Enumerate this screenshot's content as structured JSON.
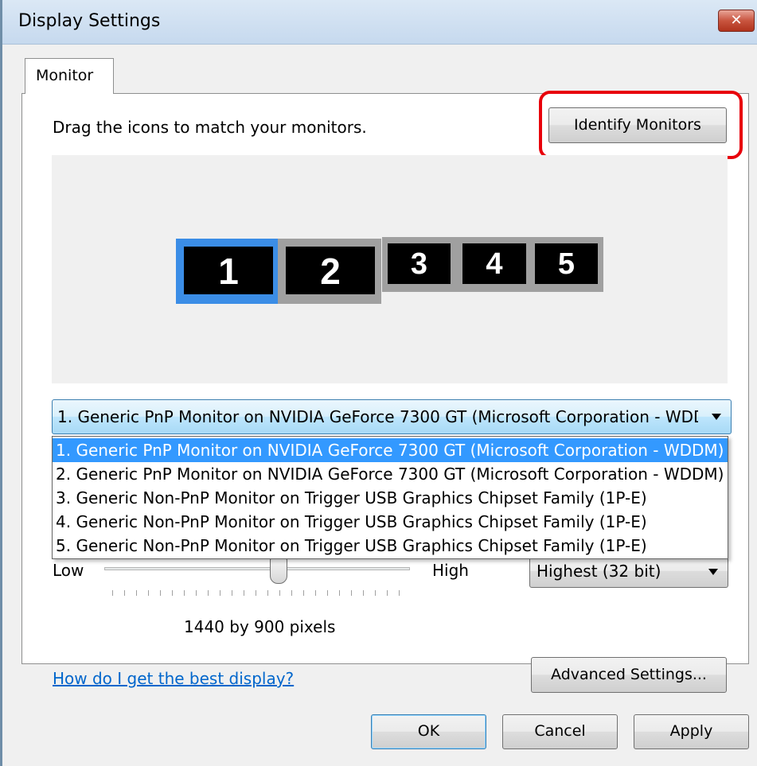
{
  "window": {
    "title": "Display Settings",
    "close_label": "✕"
  },
  "tabs": [
    {
      "label": "Monitor",
      "active": true
    }
  ],
  "instructions": "Drag the icons to match your monitors.",
  "identify_button": "Identify Monitors",
  "monitors": [
    {
      "number": "1",
      "selected": true
    },
    {
      "number": "2",
      "selected": false
    },
    {
      "number": "3",
      "selected": false
    },
    {
      "number": "4",
      "selected": false
    },
    {
      "number": "5",
      "selected": false
    }
  ],
  "monitor_select": {
    "value": "1. Generic PnP Monitor on NVIDIA GeForce 7300 GT (Microsoft Corporation - WDDM)",
    "options": [
      "1. Generic PnP Monitor on NVIDIA GeForce 7300 GT (Microsoft Corporation - WDDM)",
      "2. Generic PnP Monitor on NVIDIA GeForce 7300 GT (Microsoft Corporation - WDDM)",
      "3. Generic Non-PnP Monitor on Trigger USB Graphics Chipset Family (1P-E)",
      "4. Generic Non-PnP Monitor on Trigger USB Graphics Chipset Family (1P-E)",
      "5. Generic Non-PnP Monitor on Trigger USB Graphics Chipset Family (1P-E)"
    ],
    "highlighted_index": 0
  },
  "resolution_slider": {
    "low_label": "Low",
    "high_label": "High",
    "position_fraction": 0.57,
    "value_text": "1440 by 900 pixels"
  },
  "color_select": {
    "value": "Highest (32 bit)"
  },
  "help_link": "How do I get the best display?",
  "advanced_button": "Advanced Settings...",
  "dialog_buttons": {
    "ok": "OK",
    "cancel": "Cancel",
    "apply": "Apply"
  },
  "colors": {
    "highlight_ring": "#e8000b",
    "selection": "#3399ff",
    "link": "#0066cc",
    "selected_monitor_border": "#3b8de6"
  }
}
